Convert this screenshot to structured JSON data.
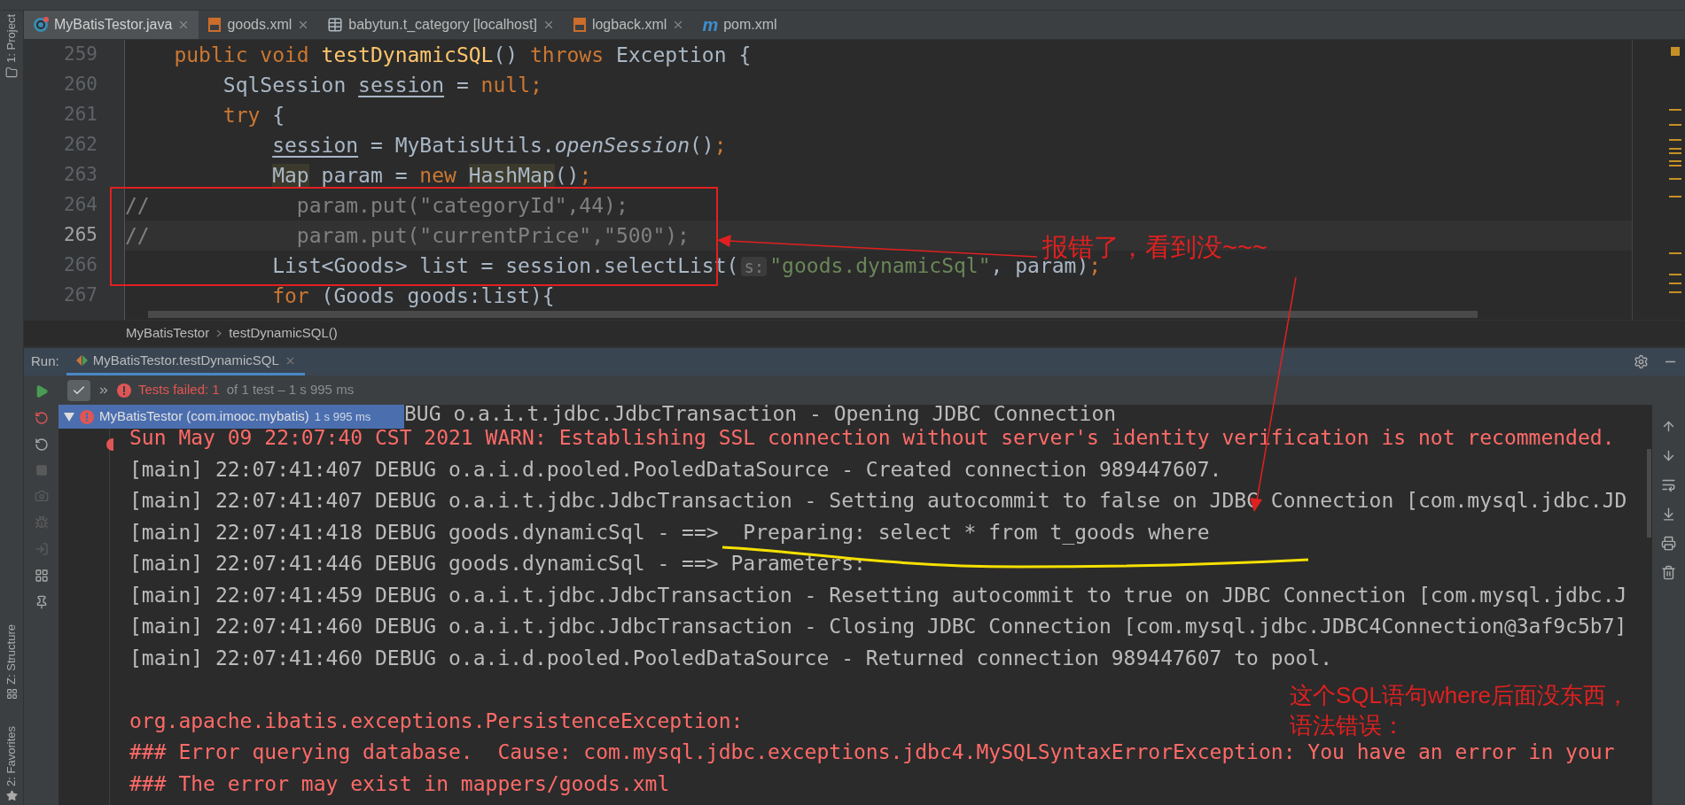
{
  "side_strip": {
    "top": "1: Project",
    "middle": "Z: Structure",
    "bottom": "2: Favorites"
  },
  "editor_tabs": [
    {
      "label": "MyBatisTestor.java",
      "kind": "class",
      "selected": true
    },
    {
      "label": "goods.xml",
      "kind": "xml",
      "selected": false
    },
    {
      "label": "babytun.t_category [localhost]",
      "kind": "table",
      "selected": false
    },
    {
      "label": "logback.xml",
      "kind": "xml",
      "selected": false
    },
    {
      "label": "pom.xml",
      "kind": "maven",
      "icon_text": "m",
      "selected": false
    }
  ],
  "editor": {
    "lines": [
      {
        "number": "259",
        "current": false,
        "tokens": [
          {
            "text": "    public void ",
            "kind": "kw"
          },
          {
            "text": "testDynamicSQL",
            "kind": "method"
          },
          {
            "text": "() ",
            "kind": "plain"
          },
          {
            "text": "throws ",
            "kind": "kw"
          },
          {
            "text": "Exception {",
            "kind": "plain"
          }
        ]
      },
      {
        "number": "260",
        "current": false,
        "tokens": [
          {
            "text": "        SqlSession ",
            "kind": "plain"
          },
          {
            "text": "session",
            "kind": "var"
          },
          {
            "text": " = ",
            "kind": "plain"
          },
          {
            "text": "null;",
            "kind": "kw"
          }
        ]
      },
      {
        "number": "261",
        "current": false,
        "tokens": [
          {
            "text": "        try ",
            "kind": "kw"
          },
          {
            "text": "{",
            "kind": "plain"
          }
        ]
      },
      {
        "number": "262",
        "current": false,
        "tokens": [
          {
            "text": "            session",
            "kind": "var"
          },
          {
            "text": " = MyBatisUtils.",
            "kind": "plain"
          },
          {
            "text": "openSession",
            "kind": "static"
          },
          {
            "text": "()",
            "kind": "plain"
          },
          {
            "text": ";",
            "kind": "kw"
          }
        ]
      },
      {
        "number": "263",
        "current": false,
        "tokens": [
          {
            "text": "            Map",
            "kind": "mark"
          },
          {
            "text": " param = ",
            "kind": "plain"
          },
          {
            "text": "new ",
            "kind": "kw"
          },
          {
            "text": "HashMap",
            "kind": "mark"
          },
          {
            "text": "()",
            "kind": "plain"
          },
          {
            "text": ";",
            "kind": "kw"
          }
        ]
      },
      {
        "number": "264",
        "current": false,
        "tokens": [
          {
            "text": "//            param.put(\"categoryId\",44);",
            "kind": "comment"
          }
        ]
      },
      {
        "number": "265",
        "current": true,
        "tokens": [
          {
            "text": "//            param.put(\"currentPrice\",\"500\");",
            "kind": "comment"
          }
        ]
      },
      {
        "number": "266",
        "current": false,
        "tokens": [
          {
            "text": "            List<Goods> list = session.selectList(",
            "kind": "plain"
          },
          {
            "text": "s:",
            "kind": "hint"
          },
          {
            "text": "\"goods.dynamicSql\"",
            "kind": "string"
          },
          {
            "text": ", param)",
            "kind": "plain"
          },
          {
            "text": ";",
            "kind": "kw"
          }
        ]
      },
      {
        "number": "267",
        "current": false,
        "tokens": [
          {
            "text": "            for ",
            "kind": "kw"
          },
          {
            "text": "(Goods goods:list){",
            "kind": "plain"
          }
        ]
      }
    ]
  },
  "breadcrumbs": [
    "MyBatisTestor",
    "testDynamicSQL()"
  ],
  "run_panel": {
    "label": "Run:",
    "tab": {
      "label": "MyBatisTestor.testDynamicSQL",
      "selected": true
    },
    "status": {
      "failed": "Tests failed: 1",
      "rest": "of 1 test – 1 s 995 ms"
    },
    "tree_item": {
      "label": "MyBatisTestor (com.imooc.mybatis)",
      "time": "1 s 995 ms",
      "selected": true
    },
    "console": {
      "partial_line": "BUG o.a.i.t.jdbc.JdbcTransaction - Opening JDBC Connection",
      "lines": [
        {
          "kind": "error",
          "text": "Sun May 09 22:07:40 CST 2021 WARN: Establishing SSL connection without server's identity verification is not recommended."
        },
        {
          "kind": "normal",
          "text": "[main] 22:07:41:407 DEBUG o.a.i.d.pooled.PooledDataSource - Created connection 989447607."
        },
        {
          "kind": "normal",
          "text": "[main] 22:07:41:407 DEBUG o.a.i.t.jdbc.JdbcTransaction - Setting autocommit to false on JDBC Connection [com.mysql.jdbc.JD"
        },
        {
          "kind": "normal",
          "text": "[main] 22:07:41:418 DEBUG goods.dynamicSql - ==>  Preparing: select * from t_goods where"
        },
        {
          "kind": "normal",
          "text": "[main] 22:07:41:446 DEBUG goods.dynamicSql - ==> Parameters:"
        },
        {
          "kind": "normal",
          "text": "[main] 22:07:41:459 DEBUG o.a.i.t.jdbc.JdbcTransaction - Resetting autocommit to true on JDBC Connection [com.mysql.jdbc.J"
        },
        {
          "kind": "normal",
          "text": "[main] 22:07:41:460 DEBUG o.a.i.t.jdbc.JdbcTransaction - Closing JDBC Connection [com.mysql.jdbc.JDBC4Connection@3af9c5b7]"
        },
        {
          "kind": "normal",
          "text": "[main] 22:07:41:460 DEBUG o.a.i.d.pooled.PooledDataSource - Returned connection 989447607 to pool."
        },
        {
          "kind": "blank"
        },
        {
          "kind": "error",
          "text": "org.apache.ibatis.exceptions.PersistenceException:"
        },
        {
          "kind": "error",
          "text": "### Error querying database.  Cause: com.mysql.jdbc.exceptions.jdbc4.MySQLSyntaxErrorException: You have an error in your"
        },
        {
          "kind": "error",
          "text": "### The error may exist in mappers/goods.xml"
        }
      ]
    }
  },
  "annotations": [
    {
      "text": "报错了，看到没~~~"
    },
    {
      "text": "这个SQL语句where后面没东西，语法错误："
    }
  ]
}
